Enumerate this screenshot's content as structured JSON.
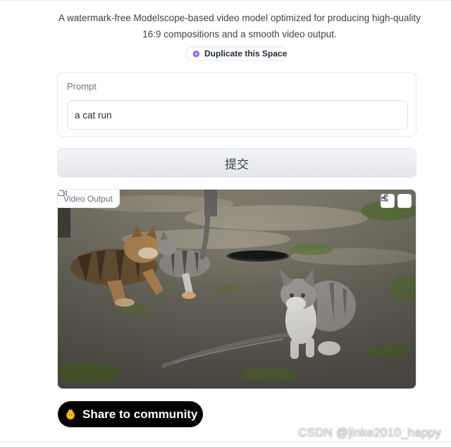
{
  "header": {
    "description_line1": "A watermark-free Modelscope-based video model optimized for producing high-quality",
    "description_line2": "16:9 compositions and a smooth video output.",
    "duplicate_label": "Duplicate this Space"
  },
  "prompt": {
    "label": "Prompt",
    "value": "a cat run"
  },
  "submit": {
    "label": "提交"
  },
  "video_output": {
    "label": "Video Output",
    "actions": [
      "download-icon",
      "share-icon"
    ]
  },
  "share": {
    "label": "Share to community",
    "icon": "community-emoji-icon"
  },
  "watermark": {
    "text": "CSDN @jinke2010_happy"
  },
  "colors": {
    "share_button_bg": "#000000",
    "duplicate_dot": "#8b5cf6",
    "border": "#e5e7eb"
  }
}
